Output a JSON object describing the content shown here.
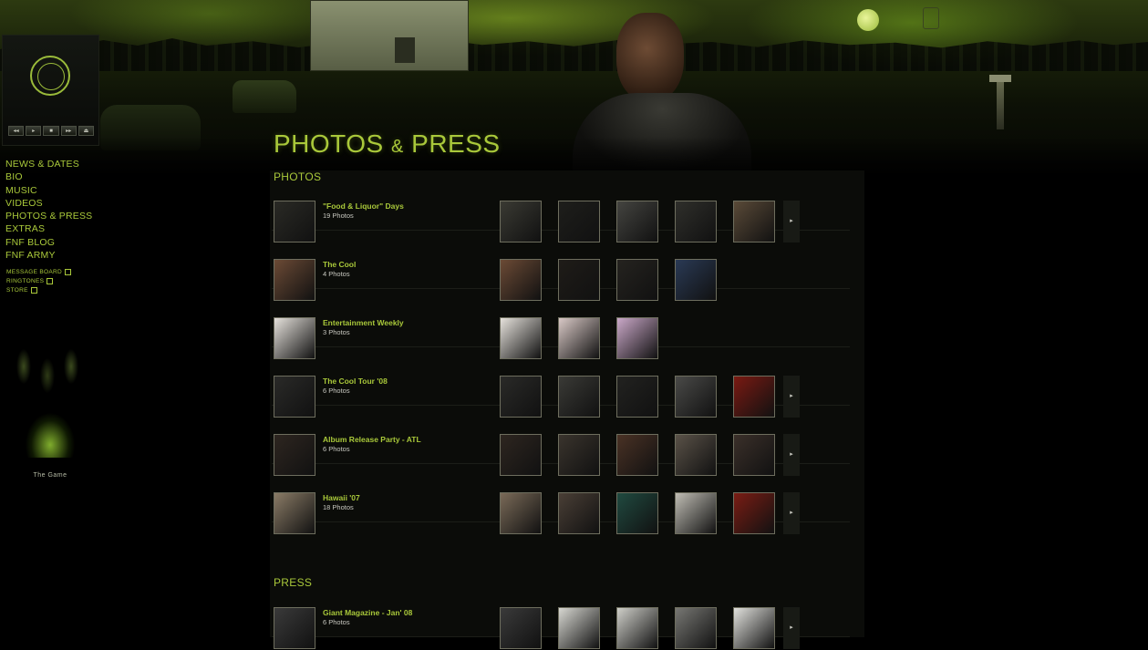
{
  "page": {
    "title_main": "PHOTOS",
    "title_amp": "&",
    "title_end": "PRESS"
  },
  "player": {
    "controls": [
      "◂◂",
      "▸",
      "■",
      "▸▸",
      "⏏"
    ]
  },
  "nav": {
    "items": [
      "NEWS & DATES",
      "BIO",
      "MUSIC",
      "VIDEOS",
      "PHOTOS & PRESS",
      "EXTRAS",
      "FNF BLOG",
      "FNF ARMY"
    ],
    "sub_items": [
      "MESSAGE BOARD",
      "RINGTONES",
      "STORE"
    ]
  },
  "stage": {
    "caption": "The Game"
  },
  "photos_section": {
    "heading": "PHOTOS",
    "albums": [
      {
        "title": "\"Food & Liquor\" Days",
        "count": "19 Photos",
        "cover": "#2a2a25",
        "thumbs": [
          "#3a3a33",
          "#1e1e1b",
          "#444440",
          "#2f2f2b",
          "#5a4a38"
        ],
        "has_next": true
      },
      {
        "title": "The Cool",
        "count": "4 Photos",
        "cover": "#6b4a35",
        "thumbs": [
          "#6b4a35",
          "#1f1c18",
          "#25231f",
          "#2a3a55"
        ],
        "has_next": false
      },
      {
        "title": "Entertainment Weekly",
        "count": "3 Photos",
        "cover": "#e6e2dc",
        "thumbs": [
          "#e6e2dc",
          "#d9c9c6",
          "#caa8c8"
        ],
        "has_next": false
      },
      {
        "title": "The Cool Tour '08",
        "count": "6 Photos",
        "cover": "#2a2a28",
        "thumbs": [
          "#2a2a28",
          "#3a3a36",
          "#222220",
          "#4a4a48",
          "#7a1a12"
        ],
        "has_next": true
      },
      {
        "title": "Album Release Party - ATL",
        "count": "6 Photos",
        "cover": "#2e2620",
        "thumbs": [
          "#2e2620",
          "#3a342d",
          "#4a3225",
          "#5a5248",
          "#3b302a"
        ],
        "has_next": true
      },
      {
        "title": "Hawaii '07",
        "count": "18 Photos",
        "cover": "#8a7b66",
        "thumbs": [
          "#7a6a58",
          "#4a3f36",
          "#204a40",
          "#c0bdb4",
          "#7a1d14"
        ],
        "has_next": true
      }
    ]
  },
  "press_section": {
    "heading": "PRESS",
    "albums": [
      {
        "title": "Giant Magazine - Jan' 08",
        "count": "6 Photos",
        "cover": "#3a3a3a",
        "thumbs": [
          "#3a3a3a",
          "#d8d8d2",
          "#cfcfc9",
          "#777773",
          "#e2e2de"
        ],
        "has_next": true
      }
    ]
  }
}
